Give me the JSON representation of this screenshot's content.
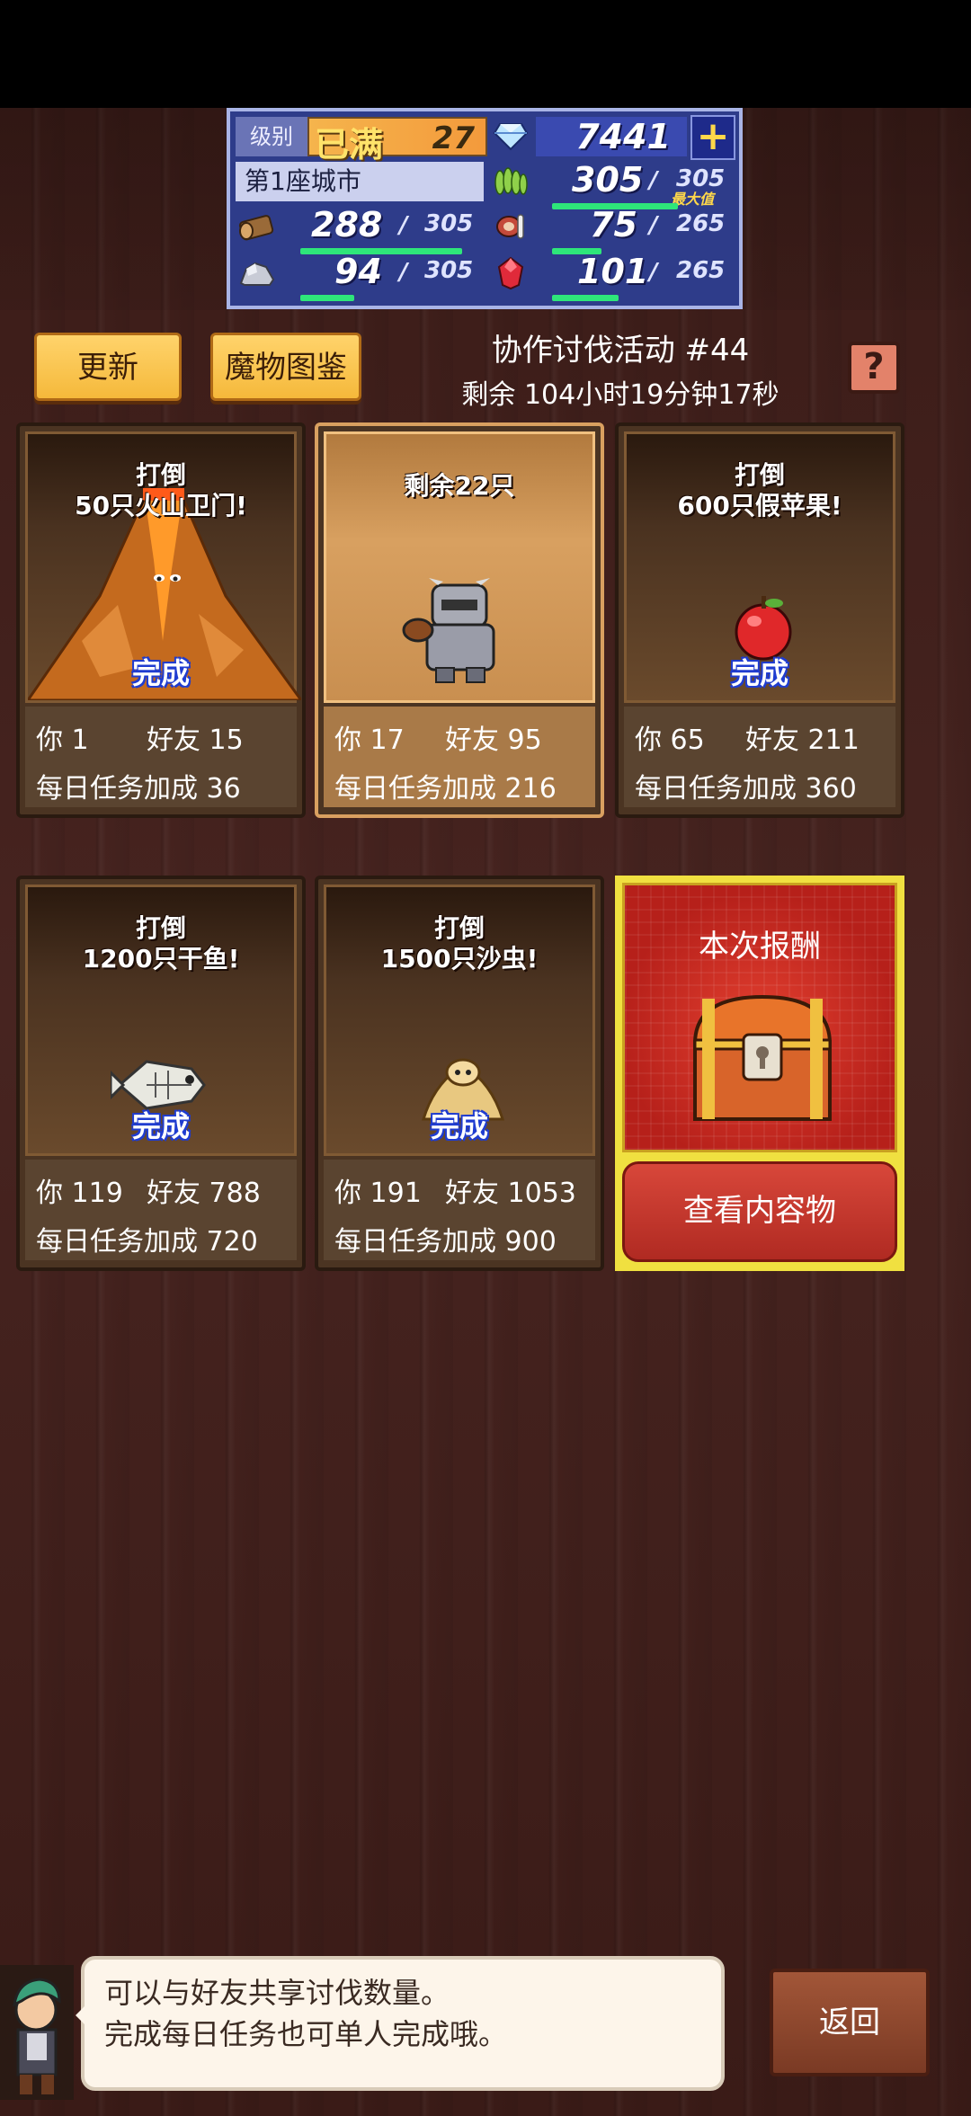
{
  "status_panel": {
    "level_label": "级别",
    "level_max": "已满",
    "level_value": "27",
    "gems": "7441",
    "city_name": "第1座城市",
    "food_current": "305",
    "food_max": "305",
    "food_max_tag": "最大值",
    "food_fill": 1.0,
    "wood_current": "288",
    "wood_max": "305",
    "wood_fill": 0.94,
    "meat_current": "75",
    "meat_max": "265",
    "meat_fill": 0.28,
    "stone_current": "94",
    "stone_max": "305",
    "stone_fill": 0.31,
    "ruby_current": "101",
    "ruby_max": "265",
    "ruby_fill": 0.38,
    "slash": "/",
    "plus_icon": "+"
  },
  "controls": {
    "refresh_label": "更新",
    "monster_book_label": "魔物图鉴",
    "event_title": "协作讨伐活动 #44",
    "event_remaining": "剩余 104小时19分钟17秒",
    "help_icon": "?"
  },
  "cards": [
    {
      "title_line1": "打倒",
      "title_line2": "50只火山卫门!",
      "status": "完成",
      "you": "你 1",
      "friends": "好友  15",
      "daily": "每日任务加成  36"
    },
    {
      "title_line1": "剩余22只",
      "title_line2": "",
      "status": "",
      "you": "你 17",
      "friends": "好友  95",
      "daily": "每日任务加成  216"
    },
    {
      "title_line1": "打倒",
      "title_line2": "600只假苹果!",
      "status": "完成",
      "you": "你 65",
      "friends": "好友  211",
      "daily": "每日任务加成  360"
    },
    {
      "title_line1": "打倒",
      "title_line2": "1200只干鱼!",
      "status": "完成",
      "you": "你 119",
      "friends": "好友  788",
      "daily": "每日任务加成  720"
    },
    {
      "title_line1": "打倒",
      "title_line2": "1500只沙虫!",
      "status": "完成",
      "you": "你 191",
      "friends": "好友  1053",
      "daily": "每日任务加成  900"
    }
  ],
  "reward": {
    "title": "本次报酬",
    "view_label": "查看内容物"
  },
  "footer": {
    "speech_line1": "可以与好友共享讨伐数量。",
    "speech_line2": "完成每日任务也可单人完成哦。",
    "back_label": "返回"
  },
  "colors": {
    "background": "#3a1a16",
    "panel_blue": "#2e3c8a",
    "accent_yellow": "#f5b93b",
    "bar_green": "#2ee67a",
    "reward_red": "#b6201a"
  },
  "icons": [
    "diamond-icon",
    "plus-icon",
    "wheat-icon",
    "log-icon",
    "meat-icon",
    "stone-icon",
    "ruby-icon",
    "help-icon",
    "volcano-icon",
    "armored-monster-icon",
    "apple-icon",
    "dried-fish-icon",
    "sandworm-icon",
    "treasure-chest-icon",
    "avatar-icon"
  ]
}
